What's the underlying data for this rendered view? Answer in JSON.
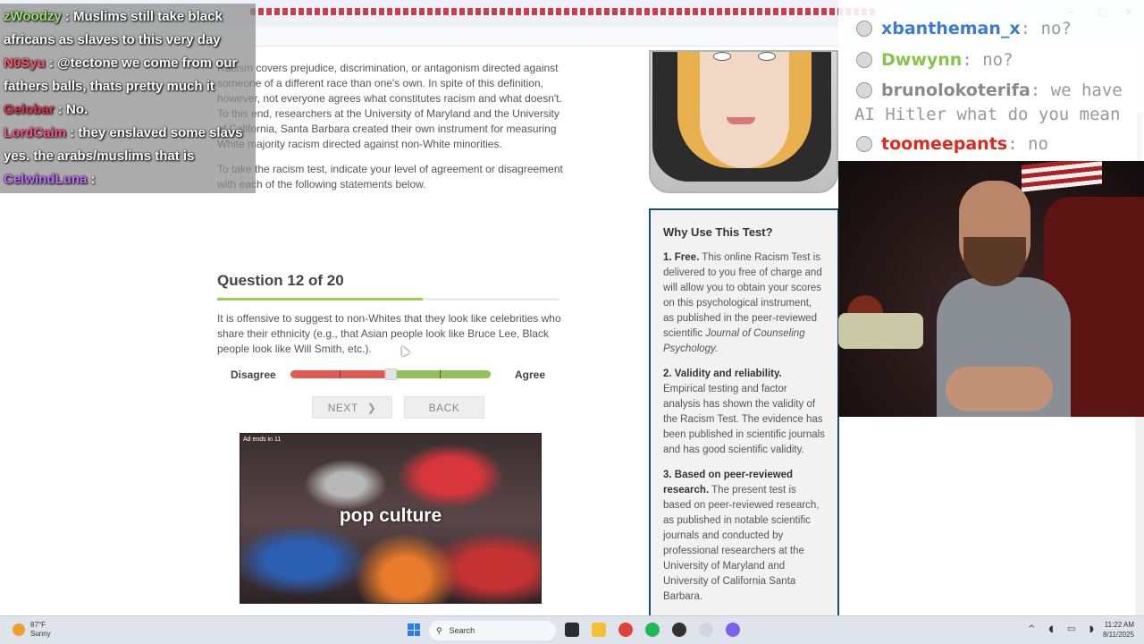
{
  "browser": {
    "minimize": "–",
    "maximize": "▢",
    "close": "✕"
  },
  "intro": {
    "para1": "Racism covers prejudice, discrimination, or antagonism directed against someone of a different race than one's own. In spite of this definition, however, not everyone agrees what constitutes racism and what doesn't. To this end, researchers at the University of Maryland and the University of California, Santa Barbara created their own instrument for measuring White majority racism directed against non-White minorities.",
    "para2": "To take the racism test, indicate your level of agreement or disagreement with each of the following statements below."
  },
  "question": {
    "title": "Question 12 of 20",
    "progress": 0.6,
    "text": "It is offensive to suggest to non-Whites that they look like celebrities who share their ethnicity (e.g., that Asian people look like Bruce Lee, Black people look like Will Smith, etc.).",
    "disagree_label": "Disagree",
    "agree_label": "Agree",
    "slider_value": 0.5,
    "next_label": "NEXT",
    "back_label": "BACK"
  },
  "ad": {
    "ends": "Ad ends in 11",
    "caption": "pop culture"
  },
  "why": {
    "heading": "Why Use This Test?",
    "items": [
      {
        "title": "1. Free.",
        "body": "This online Racism Test is delivered to you free of charge and will allow you to obtain your scores on this psychological instrument, as published in the peer-reviewed scientific",
        "journal": "Journal of Counseling Psychology."
      },
      {
        "title": "2. Validity and reliability.",
        "body": "Empirical testing and factor analysis has shown the validity of the Racism Test. The evidence has been published in scientific journals and has good scientific validity."
      },
      {
        "title": "3. Based on peer-reviewed research.",
        "body": "The present test is based on peer-reviewed research, as published in notable scientific journals and conducted by professional researchers at the University of Maryland and University of California Santa Barbara."
      }
    ]
  },
  "chat_left": [
    {
      "user": "zWoodzy",
      "color": "#9be36b",
      "text": " : Muslims still take black"
    },
    {
      "user": "",
      "color": "#ffffff",
      "text": "africans as slaves to this very day"
    },
    {
      "user": "N0Syu",
      "color": "#ff5a6b",
      "text": " : @tectone we come from our"
    },
    {
      "user": "",
      "color": "#ffffff",
      "text": "fathers balls, thats pretty much it"
    },
    {
      "user": "Gelobar",
      "color": "#e0334a",
      "text": " : No."
    },
    {
      "user": "LordCaim",
      "color": "#ff4f8a",
      "text": " : they enslaved some slavs"
    },
    {
      "user": "",
      "color": "#ffffff",
      "text": "yes. the arabs/muslims that is"
    },
    {
      "user": "CelwindLuna",
      "color": "#c86bff",
      "text": " :"
    }
  ],
  "chat_right": [
    {
      "user": "xbantheman_x",
      "color": "#3b7bd6",
      "text": " no?"
    },
    {
      "user": "Dwwynn",
      "color": "#86c44a",
      "text": " no?"
    },
    {
      "user": "brunolokoterifa",
      "color": "#8a8a8a",
      "text": " we have"
    },
    {
      "user": "",
      "color": "#8a8a8a",
      "text": "AI Hitler what do you mean"
    },
    {
      "user": "toomeepants",
      "color": "#e0281e",
      "text": " no"
    }
  ],
  "taskbar": {
    "temp": "87°F",
    "weather": "Sunny",
    "search": "Search",
    "time": "11:22 AM",
    "date": "8/11/2025"
  }
}
